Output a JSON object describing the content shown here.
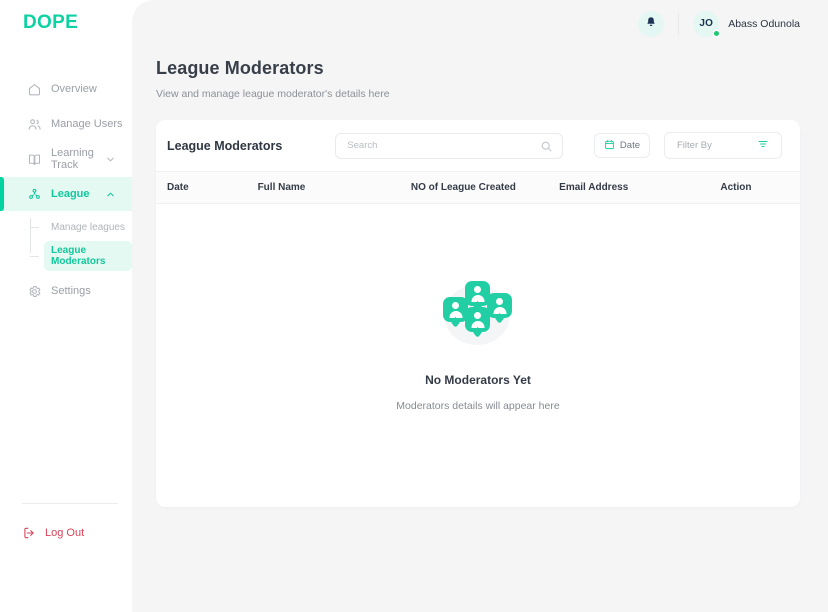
{
  "brand": {
    "logo": "DOPE",
    "accent": "#0ed2a3"
  },
  "sidebar": {
    "items": [
      {
        "label": "Overview",
        "icon": "home-icon"
      },
      {
        "label": "Manage Users",
        "icon": "users-icon"
      },
      {
        "label": "Learning Track",
        "icon": "book-icon",
        "chevron": "chevron-down-icon"
      },
      {
        "label": "League",
        "icon": "league-icon",
        "chevron": "chevron-up-icon",
        "active": true
      }
    ],
    "subitems": [
      {
        "label": "Manage leagues"
      },
      {
        "label": "League Moderators",
        "active": true
      }
    ],
    "settings": {
      "label": "Settings",
      "icon": "gear-icon"
    },
    "logout": {
      "label": "Log Out",
      "icon": "logout-icon",
      "color": "#d94458"
    }
  },
  "topbar": {
    "notification_icon": "bell-icon",
    "user": {
      "initials": "JO",
      "name": "Abass Odunola",
      "status": "online"
    }
  },
  "page": {
    "title": "League Moderators",
    "subtitle": "View and manage league  moderator's details here"
  },
  "card": {
    "title": "League Moderators",
    "search": {
      "placeholder": "Search",
      "value": "",
      "icon": "search-icon"
    },
    "date_button": {
      "label": "Date",
      "icon": "calendar-icon"
    },
    "filter_button": {
      "label": "Filter By",
      "icon": "filter-icon"
    },
    "table": {
      "columns": [
        "Date",
        "Full Name",
        "NO of League Created",
        "Email Address",
        "Action"
      ],
      "rows": []
    },
    "empty_state": {
      "illustration": "moderators-group-illustration",
      "title": "No Moderators Yet",
      "subtitle": "Moderators details will appear here"
    }
  }
}
